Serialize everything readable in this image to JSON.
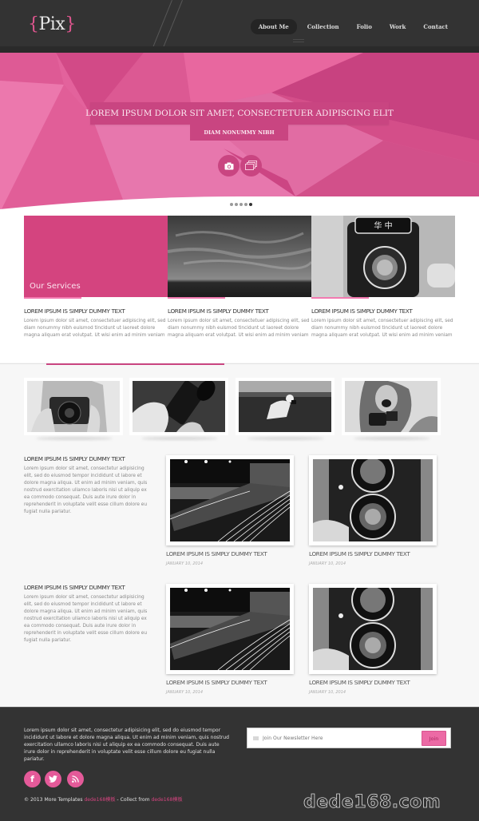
{
  "header": {
    "logo": {
      "open_brace": "{",
      "text": "Pix",
      "close_brace": "}"
    },
    "nav": [
      {
        "label": "About Me",
        "active": true
      },
      {
        "label": "Collection",
        "active": false
      },
      {
        "label": "Folio",
        "active": false
      },
      {
        "label": "Work",
        "active": false
      },
      {
        "label": "Contact",
        "active": false
      }
    ]
  },
  "hero": {
    "title": "LOREM IPSUM DOLOR SIT AMET, CONSECTETUER ADIPISCING ELIT",
    "subtitle": "DIAM NONUMMY NIBH",
    "buttons": [
      {
        "icon": "camera-icon"
      },
      {
        "icon": "gallery-icon"
      }
    ],
    "slider": {
      "total": 5,
      "active_index": 4
    }
  },
  "services": {
    "label": "Our Services",
    "columns": [
      {
        "title": "LOREM IPSUM IS SIMPLY DUMMY TEXT",
        "body": "Lorem ipsum dolor sit amet, consectetuer adipiscing elit, sed diam nonummy nibh euismod tincidunt ut laoreet dolore magna aliquam erat volutpat. Ut wisi enim ad minim veniam"
      },
      {
        "title": "LOREM IPSUM IS SIMPLY DUMMY TEXT",
        "body": "Lorem ipsum dolor sit amet, consectetuer adipiscing elit, sed diam nonummy nibh euismod tincidunt ut laoreet dolore magna aliquam erat volutpat. Ut wisi enim ad minim veniam"
      },
      {
        "title": "LOREM IPSUM IS SIMPLY DUMMY TEXT",
        "body": "Lorem ipsum dolor sit amet, consectetuer adipiscing elit, sed diam nonummy nibh euismod tincidunt ut laoreet dolore magna aliquam erat volutpat. Ut wisi enim ad minim veniam"
      }
    ]
  },
  "gallery": {
    "thumbs": [
      {
        "subject": "woman-with-camera"
      },
      {
        "subject": "hands-with-lens"
      },
      {
        "subject": "photographer-in-field"
      },
      {
        "subject": "laughing-woman-with-camcorder"
      }
    ]
  },
  "posts": [
    {
      "title": "LOREM IPSUM IS SIMPLY DUMMY TEXT",
      "body": "Lorem ipsum dolor sit amet, consectetur adipisicing elit, sed do eiusmod tempor incididunt ut labore et dolore magna aliqua. Ut enim ad minim veniam, quis nostrud exercitation ullamco laboris nisi ut aliquip ex ea commodo consequat. Duis aute irure dolor in reprehenderit in voluptate velit esse cillum dolore eu fugiat nulla pariatur.",
      "cards": [
        {
          "subject": "night-highway",
          "caption": "LOREM IPSUM IS SIMPLY DUMMY TEXT",
          "date": "JANUARY 10, 2014"
        },
        {
          "subject": "twin-lens-camera",
          "caption": "LOREM IPSUM IS SIMPLY DUMMY TEXT",
          "date": "JANUARY 10, 2014"
        }
      ]
    },
    {
      "title": "LOREM IPSUM IS SIMPLY DUMMY TEXT",
      "body": "Lorem ipsum dolor sit amet, consectetur adipisicing elit, sed do eiusmod tempor incididunt ut labore et dolore magna aliqua. Ut enim ad minim veniam, quis nostrud exercitation ullamco laboris nisi ut aliquip ex ea commodo consequat. Duis aute irure dolor in reprehenderit in voluptate velit esse cillum dolore eu fugiat nulla pariatur.",
      "cards": [
        {
          "subject": "night-highway",
          "caption": "LOREM IPSUM IS SIMPLY DUMMY TEXT",
          "date": "JANUARY 10, 2014"
        },
        {
          "subject": "twin-lens-camera",
          "caption": "LOREM IPSUM IS SIMPLY DUMMY TEXT",
          "date": "JANUARY 10, 2014"
        }
      ]
    }
  ],
  "footer": {
    "text": "Lorem ipsum dolor sit amet, consectetur adipisicing elit, sed do eiusmod tempor incididunt ut labore et dolore magna aliqua. Ut enim ad minim veniam, quis nostrud exercitation ullamco laboris nisi ut aliquip ex ea commodo consequat. Duis aute irure dolor in reprehenderit in voluptate velit esse cillum dolore eu fugiat nulla pariatur.",
    "social": [
      {
        "name": "facebook",
        "glyph": "f"
      },
      {
        "name": "twitter",
        "glyph": "t"
      },
      {
        "name": "rss",
        "glyph": "rss"
      }
    ],
    "copyright_prefix": "© 2013 More Templates ",
    "link1": "dede168模板",
    "copyright_mid": " - Collect from ",
    "link2": "dede168模板",
    "newsletter": {
      "placeholder": "Join Our Newsletter Here",
      "button": "Join"
    },
    "watermark": "dede168.com"
  },
  "colors": {
    "accent": "#d4447f",
    "accent_light": "#e45a99",
    "header_bg": "#333333",
    "footer_bg": "#333333"
  }
}
